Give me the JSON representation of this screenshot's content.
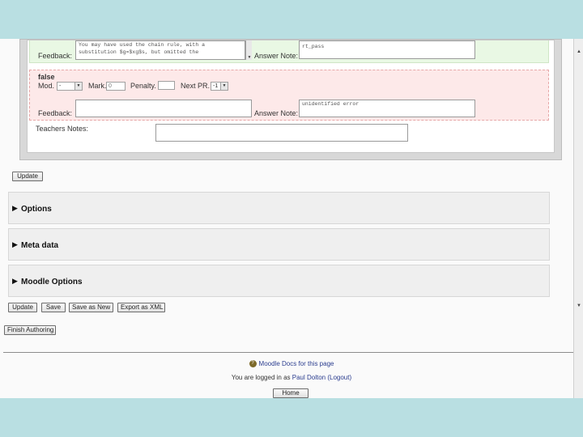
{
  "editor": {
    "true_branch": {
      "feedback_label": "Feedback:",
      "feedback_text": "You may have used the chain rule, with a\nsubstitution $g=$xg$s, but omitted the",
      "answer_note_label": "Answer Note:",
      "answer_note_value": "rt_pass"
    },
    "false_branch": {
      "title": "false",
      "mod_label": "Mod.",
      "mod_value": "-",
      "mark_label": "Mark.",
      "mark_value": "0",
      "penalty_label": "Penalty.",
      "penalty_value": "",
      "next_pr_label": "Next PR.",
      "next_pr_value": "-1",
      "feedback_label": "Feedback:",
      "feedback_text": "",
      "answer_note_label": "Answer Note:",
      "answer_note_value": "unidentified error"
    },
    "teachers_notes_label": "Teachers Notes:",
    "teachers_notes_value": ""
  },
  "update_button_top": "Update",
  "sections": [
    {
      "title": "Options"
    },
    {
      "title": "Meta data"
    },
    {
      "title": "Moodle Options"
    }
  ],
  "action_buttons": {
    "update": "Update",
    "save": "Save",
    "save_as_new": "Save as New",
    "export_xml": "Export as XML"
  },
  "finish_authoring": "Finish Authoring",
  "footer": {
    "docs_link": "Moodle Docs for this page",
    "logged_in_prefix": "You are logged in as",
    "user_name": "Paul Dolton",
    "logout": "(Logout)",
    "home_button": "Home"
  }
}
